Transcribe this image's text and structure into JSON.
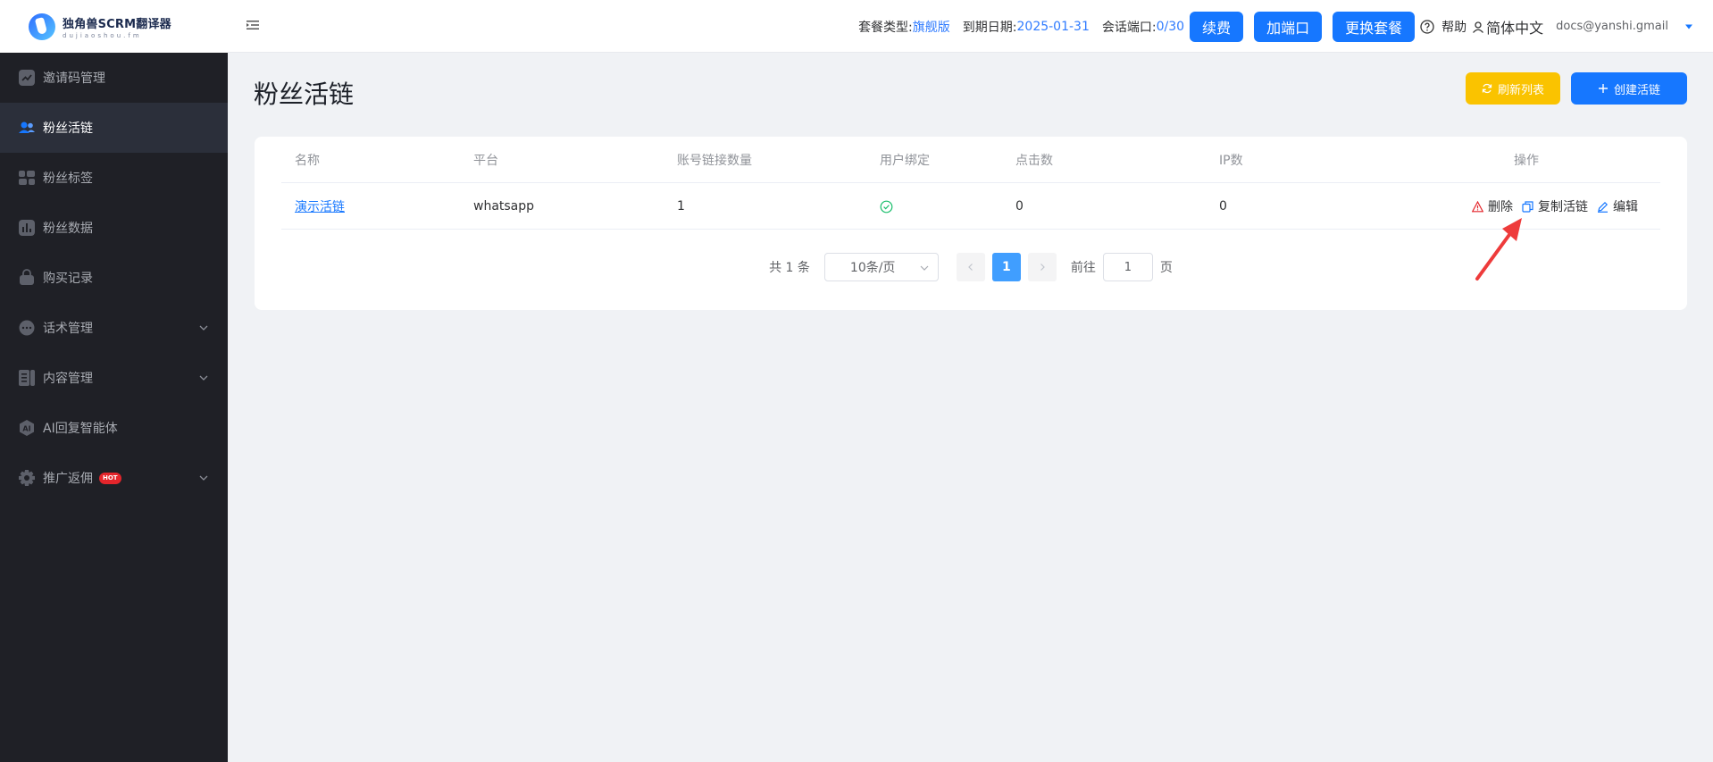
{
  "brand": {
    "title": "独角兽SCRM翻译器",
    "subtitle": "dujiaoshou.fm"
  },
  "sidebar": {
    "items": [
      {
        "label": "邀请码管理",
        "icon": "chart-trend-icon",
        "active": false,
        "expandable": false
      },
      {
        "label": "粉丝活链",
        "icon": "users-icon",
        "active": true,
        "expandable": false
      },
      {
        "label": "粉丝标签",
        "icon": "tag-icon",
        "active": false,
        "expandable": false
      },
      {
        "label": "粉丝数据",
        "icon": "bar-chart-icon",
        "active": false,
        "expandable": false
      },
      {
        "label": "购买记录",
        "icon": "shopping-bag-icon",
        "active": false,
        "expandable": false
      },
      {
        "label": "话术管理",
        "icon": "chat-icon",
        "active": false,
        "expandable": true
      },
      {
        "label": "内容管理",
        "icon": "document-icon",
        "active": false,
        "expandable": true
      },
      {
        "label": "AI回复智能体",
        "icon": "ai-icon",
        "active": false,
        "expandable": false
      },
      {
        "label": "推广返佣",
        "icon": "gear-icon",
        "active": false,
        "expandable": true,
        "badge": "HOT"
      }
    ]
  },
  "header": {
    "plan_label": "套餐类型:",
    "plan_value": "旗舰版",
    "expiry_label": "到期日期:",
    "expiry_value": "2025-01-31",
    "ports_label": "会话端口:",
    "ports_value": "0/30",
    "renew_button": "续费",
    "add_port_button": "加端口",
    "change_plan_button": "更换套餐",
    "help_label": "帮助",
    "language": "简体中文",
    "user_email": "docs@yanshi.gmail"
  },
  "page": {
    "title": "粉丝活链",
    "refresh_button": "刷新列表",
    "create_button": "创建活链"
  },
  "table": {
    "columns": [
      "名称",
      "平台",
      "账号链接数量",
      "用户绑定",
      "点击数",
      "IP数",
      "操作"
    ],
    "rows": [
      {
        "name": "演示活链",
        "platform": "whatsapp",
        "account_links": "1",
        "user_bound": true,
        "clicks": "0",
        "ips": "0",
        "actions": {
          "delete": "删除",
          "copy": "复制活链",
          "edit": "编辑"
        }
      }
    ]
  },
  "pagination": {
    "total_text": "共 1 条",
    "page_size": "10条/页",
    "current_page": "1",
    "goto_label": "前往",
    "goto_value": "1",
    "page_unit": "页"
  },
  "colors": {
    "primary": "#1677ff",
    "warning": "#fac300",
    "sidebar_bg": "#1f2026",
    "danger": "#e4252b",
    "success": "#19be6b"
  }
}
